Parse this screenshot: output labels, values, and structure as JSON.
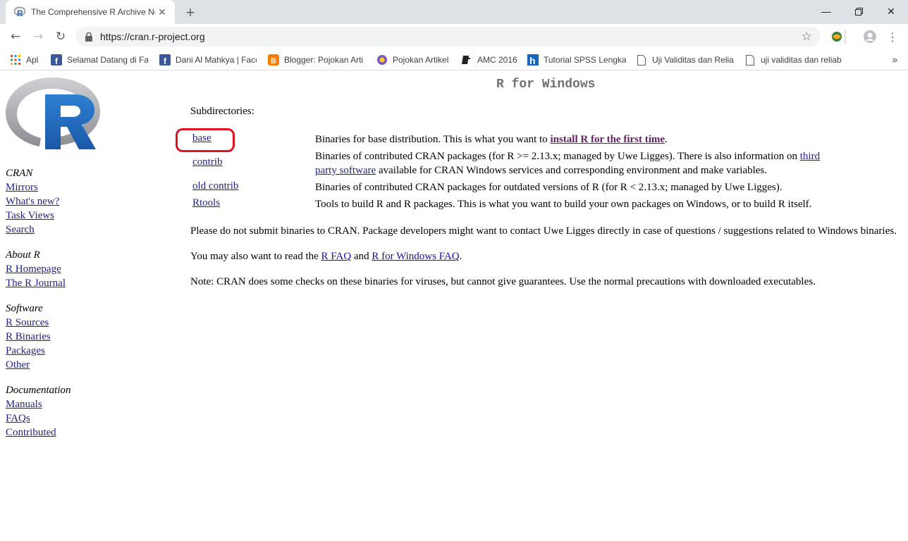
{
  "browser": {
    "tab_title": "The Comprehensive R Archive Network",
    "url": "https://cran.r-project.org",
    "bookmarks": [
      {
        "label": "Apl",
        "icon": "apps-grid-icon"
      },
      {
        "label": "Selamat Datang di Fa",
        "icon": "facebook-icon"
      },
      {
        "label": "Dani Al Mahkya | Face",
        "icon": "facebook-icon"
      },
      {
        "label": "Blogger: Pojokan Arti",
        "icon": "blogger-icon"
      },
      {
        "label": "Pojokan Artikel",
        "icon": "pojokan-icon"
      },
      {
        "label": "AMC 2016",
        "icon": "amc-icon"
      },
      {
        "label": "Tutorial SPSS Lengkap",
        "icon": "h-icon"
      },
      {
        "label": "Uji Validitas dan Relia",
        "icon": "page-icon"
      },
      {
        "label": "uji validitas dan reliab",
        "icon": "page-icon"
      }
    ],
    "colors": {
      "tabstrip": "#dee1e6",
      "omnibox": "#f1f3f4"
    }
  },
  "page": {
    "title": "R for Windows",
    "subdirectories_label": "Subdirectories:",
    "directories": [
      {
        "name": "base",
        "desc_pre": "Binaries for base distribution. This is what you want to ",
        "desc_link": "install R for the first time",
        "desc_post": "."
      },
      {
        "name": "contrib",
        "desc_pre": "Binaries of contributed CRAN packages (for R >= 2.13.x; managed by Uwe Ligges). There is also information on ",
        "desc_link": "third party software",
        "desc_post": " available for CRAN Windows services and corresponding environment and make variables."
      },
      {
        "name": "old contrib",
        "desc_pre": "Binaries of contributed CRAN packages for outdated versions of R (for R < 2.13.x; managed by Uwe Ligges).",
        "desc_link": "",
        "desc_post": ""
      },
      {
        "name": "Rtools",
        "desc_pre": "Tools to build R and R packages. This is what you want to build your own packages on Windows, or to build R itself.",
        "desc_link": "",
        "desc_post": ""
      }
    ],
    "para1": "Please do not submit binaries to CRAN. Package developers might want to contact Uwe Ligges directly in case of questions / suggestions related to Windows binaries.",
    "para2_pre": "You may also want to read the ",
    "para2_link1": "R FAQ",
    "para2_mid": " and ",
    "para2_link2": "R for Windows FAQ",
    "para2_post": ".",
    "para3": "Note: CRAN does some checks on these binaries for viruses, but cannot give guarantees. Use the normal precautions with downloaded executables.",
    "highlight_color": "#e0141e"
  },
  "sidebar": {
    "sections": [
      {
        "heading": "CRAN",
        "links": [
          "Mirrors",
          "What's new?",
          "Task Views",
          "Search"
        ]
      },
      {
        "heading": "About R",
        "links": [
          "R Homepage",
          "The R Journal"
        ]
      },
      {
        "heading": "Software",
        "links": [
          "R Sources",
          "R Binaries",
          "Packages",
          "Other"
        ]
      },
      {
        "heading": "Documentation",
        "links": [
          "Manuals",
          "FAQs",
          "Contributed"
        ]
      }
    ]
  }
}
